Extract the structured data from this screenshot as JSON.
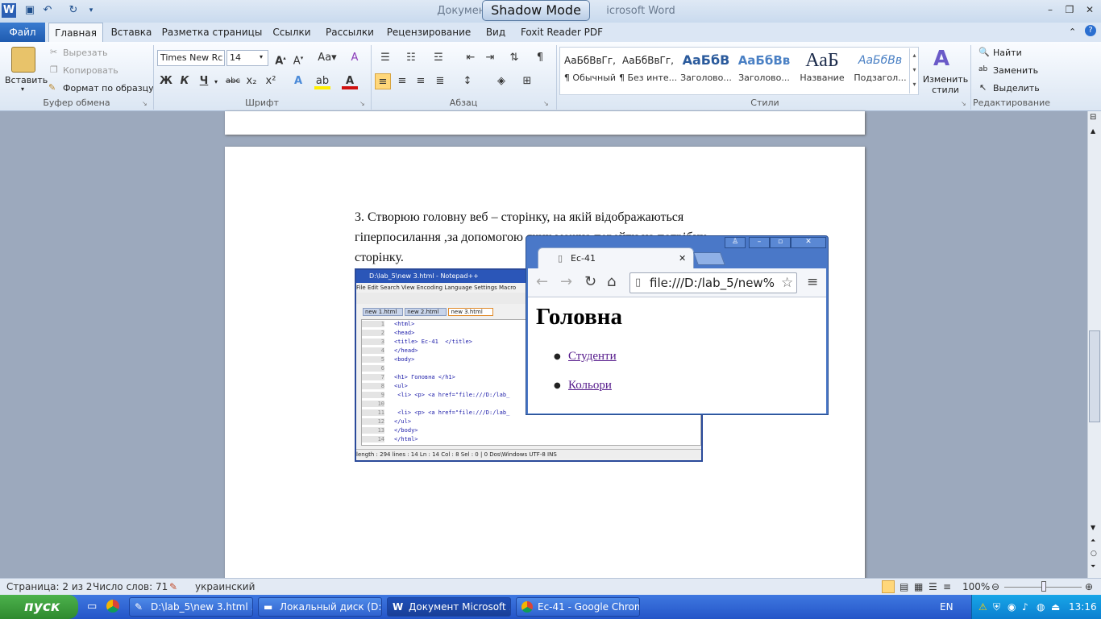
{
  "window": {
    "title_left": "Докумен",
    "title_right": "icrosoft Word",
    "shadow_mode": "Shadow Mode",
    "controls": [
      "–",
      "❐",
      "✕"
    ]
  },
  "ribbon_tabs": {
    "file": "Файл",
    "tabs": [
      "Главная",
      "Вставка",
      "Разметка страницы",
      "Ссылки",
      "Рассылки",
      "Рецензирование",
      "Вид",
      "Foxit Reader PDF"
    ]
  },
  "clipboard": {
    "paste": "Вставить",
    "cut": "Вырезать",
    "copy": "Копировать",
    "format_painter": "Формат по образцу",
    "group": "Буфер обмена"
  },
  "font": {
    "name": "Times New Rc",
    "size": "14",
    "bold": "Ж",
    "italic": "К",
    "underline": "Ч",
    "strike": "abc",
    "sub": "x₂",
    "sup": "x²",
    "group": "Шрифт"
  },
  "paragraph": {
    "group": "Абзац"
  },
  "styles": {
    "items": [
      {
        "sample": "АаБбВвГг,",
        "name": "¶ Обычный"
      },
      {
        "sample": "АаБбВвГг,",
        "name": "¶ Без инте..."
      },
      {
        "sample": "АаБбВ",
        "name": "Заголово..."
      },
      {
        "sample": "АаБбВв",
        "name": "Заголово..."
      },
      {
        "sample": "АаБ",
        "name": "Название"
      },
      {
        "sample": "АаБбВв",
        "name": "Подзагол..."
      }
    ],
    "change": "Изменить стили",
    "group": "Стили"
  },
  "editing": {
    "find": "Найти",
    "replace": "Заменить",
    "select": "Выделить",
    "group": "Редактирование"
  },
  "document": {
    "line1": "3. Створюю головну веб – сторінку, на якій відображаються",
    "line2": "гіперпосилання ,за допомогою яких можна перейти на потрібну",
    "line3": "сторінку."
  },
  "notepad": {
    "title": "D:\\lab_5\\new 3.html - Notepad++",
    "menu": "File  Edit  Search  View  Encoding  Language  Settings  Macro",
    "tabs": [
      "new 1.html",
      "new 2.html",
      "new 3.html"
    ],
    "lines": [
      "<html>",
      "<head>",
      "<title> Ес-41  </title>",
      "</head>",
      "<body>",
      "",
      "<h1> Головна </h1>",
      "<ul>",
      " <li> <p> <a href=\"file:///D:/lab_",
      "",
      " <li> <p> <a href=\"file:///D:/lab_",
      "</ul>",
      "</body>",
      "</html>"
    ],
    "status": "length : 294   lines : 14        Ln : 14   Col : 8   Sel : 0 | 0             Dos\\Windows         UTF-8              INS"
  },
  "chrome": {
    "tab_title": "Ес-41",
    "url": "file:///D:/lab_5/new%",
    "heading": "Головна",
    "links": [
      "Студенти",
      "Кольори"
    ]
  },
  "statusbar": {
    "page": "Страница: 2 из 2",
    "words": "Число слов: 71",
    "language": "украинский",
    "zoom": "100%"
  },
  "taskbar": {
    "start": "пуск",
    "buttons": [
      "D:\\lab_5\\new  3.html ...",
      "Локальный диск (D:)",
      "Документ Microsoft ...",
      "Ес-41 - Google Chrome"
    ],
    "lang": "EN",
    "clock": "13:16"
  }
}
